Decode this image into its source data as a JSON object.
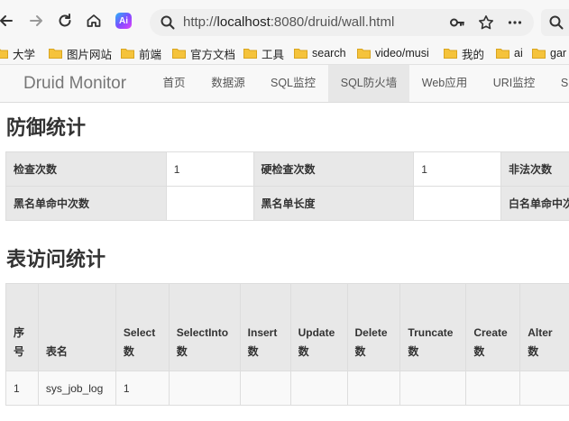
{
  "browser": {
    "url_scheme": "http://",
    "url_host": "localhost",
    "url_rest": ":8080/druid/wall.html",
    "ai_badge": "Ai",
    "bookmarks": [
      {
        "label": "大学"
      },
      {
        "label": "图片网站"
      },
      {
        "label": "前端"
      },
      {
        "label": "官方文档"
      },
      {
        "label": "工具"
      },
      {
        "label": "search"
      },
      {
        "label": "video/musi"
      },
      {
        "label": "我的"
      },
      {
        "label": "ai"
      },
      {
        "label": "gar"
      }
    ]
  },
  "app_nav": {
    "brand": "Druid Monitor",
    "items": [
      {
        "label": "首页"
      },
      {
        "label": "数据源"
      },
      {
        "label": "SQL监控"
      },
      {
        "label": "SQL防火墙"
      },
      {
        "label": "Web应用"
      },
      {
        "label": "URI监控"
      },
      {
        "label": "S"
      }
    ]
  },
  "defense": {
    "title": "防御统计",
    "rows": [
      [
        {
          "label": "检查次数",
          "value": "1"
        },
        {
          "label": "硬检查次数",
          "value": "1"
        },
        {
          "label": "非法次数",
          "value": ""
        }
      ],
      [
        {
          "label": "黑名单命中次数",
          "value": ""
        },
        {
          "label": "黑名单长度",
          "value": ""
        },
        {
          "label": "白名单命中次",
          "value": ""
        }
      ]
    ]
  },
  "access": {
    "title": "表访问统计",
    "headers": [
      [
        "序",
        "号"
      ],
      [
        "表名"
      ],
      [
        "Select",
        "数"
      ],
      [
        "SelectInto",
        "数"
      ],
      [
        "Insert",
        "数"
      ],
      [
        "Update",
        "数"
      ],
      [
        "Delete",
        "数"
      ],
      [
        "Truncate",
        "数"
      ],
      [
        "Create",
        "数"
      ],
      [
        "Alter",
        "数"
      ]
    ],
    "rows": [
      [
        "1",
        "sys_job_log",
        "1",
        "",
        "",
        "",
        "",
        "",
        "",
        ""
      ]
    ]
  }
}
